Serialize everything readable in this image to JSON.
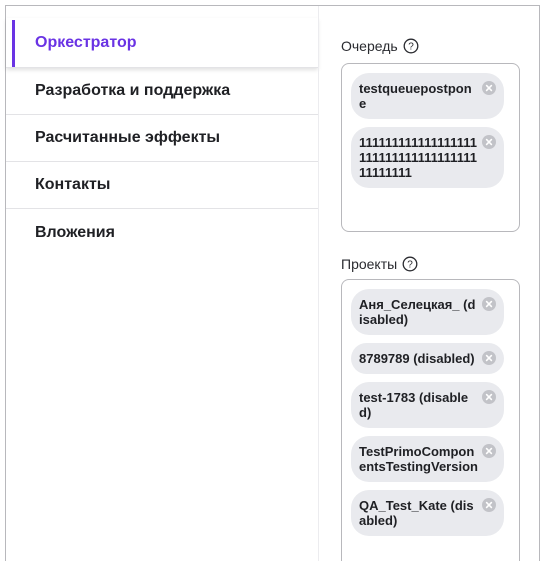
{
  "nav": {
    "items": [
      {
        "label": "Оркестратор",
        "active": true
      },
      {
        "label": "Разработка и поддержка",
        "active": false
      },
      {
        "label": "Расчитанные эффекты",
        "active": false
      },
      {
        "label": "Контакты",
        "active": false
      },
      {
        "label": "Вложения",
        "active": false
      }
    ]
  },
  "queue": {
    "label": "Очередь",
    "tags": [
      "testqueuepostpone",
      "11111111111111111111111111111111111111111111"
    ]
  },
  "projects": {
    "label": "Проекты",
    "tags": [
      "Аня_Селецкая_ (disabled)",
      "8789789 (disabled)",
      "test-1783 (disabled)",
      "TestPrimoComponentsTestingVersion",
      "QA_Test_Kate (disabled)"
    ]
  },
  "colors": {
    "accent": "#6a33e4",
    "tag_bg": "#e9eaee",
    "remove_icon": "#c2c3c8"
  },
  "icons": {
    "help": "question-circle-icon",
    "remove": "close-circle-icon"
  }
}
